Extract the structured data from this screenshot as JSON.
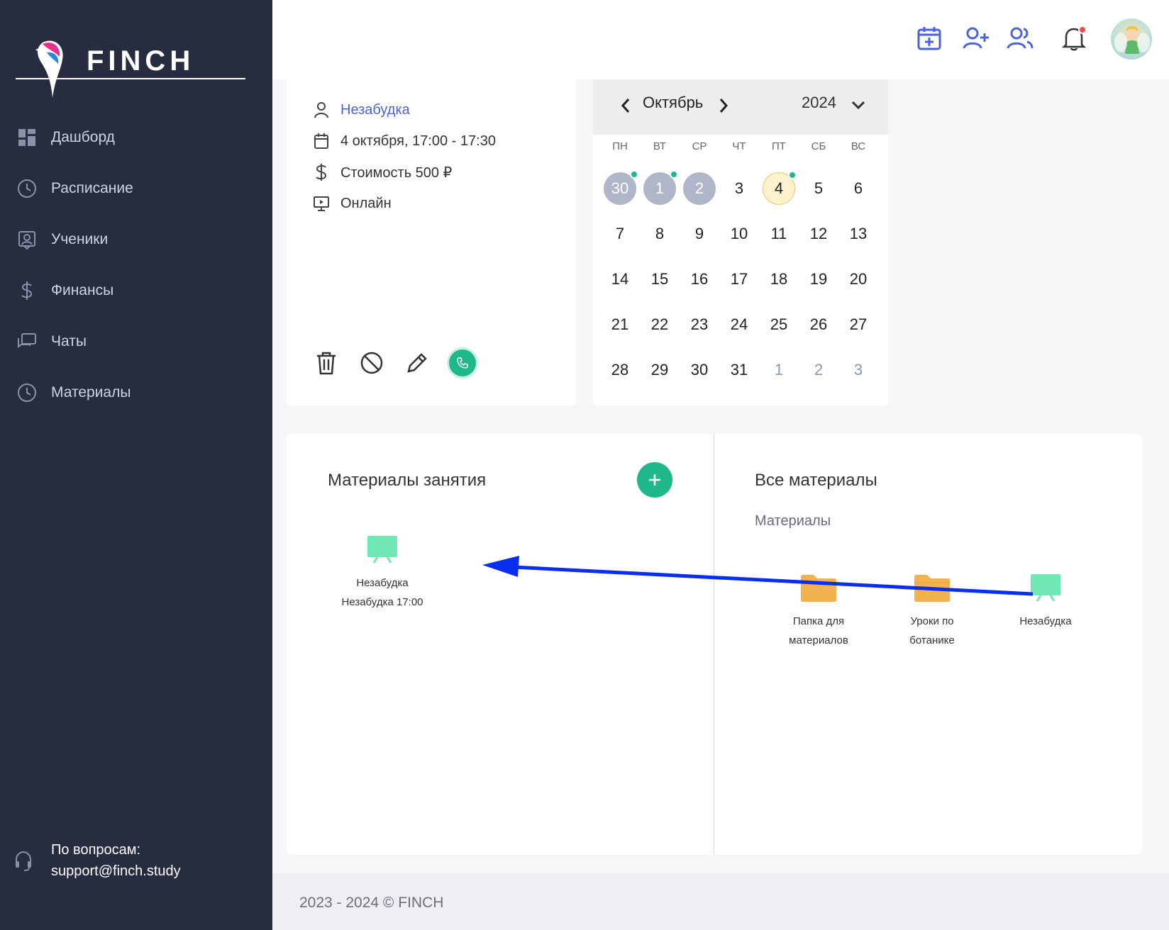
{
  "brand": {
    "name": "FINCH"
  },
  "sidebar": {
    "items": [
      {
        "label": "Дашборд",
        "icon": "dashboard-icon"
      },
      {
        "label": "Расписание",
        "icon": "clock-icon"
      },
      {
        "label": "Ученики",
        "icon": "student-icon"
      },
      {
        "label": "Финансы",
        "icon": "dollar-icon"
      },
      {
        "label": "Чаты",
        "icon": "chat-icon"
      },
      {
        "label": "Материалы",
        "icon": "clock-icon"
      }
    ],
    "support": {
      "line1": "По вопросам:",
      "line2": "support@finch.study"
    }
  },
  "topbar": {
    "icons": [
      "calendar-add-icon",
      "user-add-icon",
      "users-icon",
      "bell-icon"
    ],
    "accent": "#4b63d8",
    "notification_color": "#ef4d4d"
  },
  "lesson": {
    "student": "Незабудка",
    "datetime": "4 октября, 17:00 - 17:30",
    "price": "Стоимость 500 ₽",
    "format": "Онлайн"
  },
  "calendar": {
    "month": "Октябрь",
    "year": "2024",
    "weekdays": [
      "ПН",
      "ВТ",
      "СР",
      "ЧТ",
      "ПТ",
      "СБ",
      "ВС"
    ],
    "weeks": [
      [
        {
          "d": "30",
          "s": "past",
          "dot": true
        },
        {
          "d": "1",
          "s": "past",
          "dot": true
        },
        {
          "d": "2",
          "s": "past"
        },
        {
          "d": "3"
        },
        {
          "d": "4",
          "s": "today",
          "dot": true
        },
        {
          "d": "5"
        },
        {
          "d": "6"
        }
      ],
      [
        {
          "d": "7"
        },
        {
          "d": "8"
        },
        {
          "d": "9"
        },
        {
          "d": "10"
        },
        {
          "d": "11"
        },
        {
          "d": "12"
        },
        {
          "d": "13"
        }
      ],
      [
        {
          "d": "14"
        },
        {
          "d": "15"
        },
        {
          "d": "16"
        },
        {
          "d": "17"
        },
        {
          "d": "18"
        },
        {
          "d": "19"
        },
        {
          "d": "20"
        }
      ],
      [
        {
          "d": "21"
        },
        {
          "d": "22"
        },
        {
          "d": "23"
        },
        {
          "d": "24"
        },
        {
          "d": "25"
        },
        {
          "d": "26"
        },
        {
          "d": "27"
        }
      ],
      [
        {
          "d": "28"
        },
        {
          "d": "29"
        },
        {
          "d": "30"
        },
        {
          "d": "31"
        },
        {
          "d": "1",
          "s": "other"
        },
        {
          "d": "2",
          "s": "other"
        },
        {
          "d": "3",
          "s": "other"
        }
      ]
    ]
  },
  "materials": {
    "lesson_title": "Материалы занятия",
    "lesson_item": {
      "line1": "Незабудка",
      "line2": "Незабудка 17:00"
    },
    "all_title": "Все материалы",
    "all_subtitle": "Материалы",
    "all_items": [
      {
        "line1": "Папка для",
        "line2": "материалов",
        "type": "folder"
      },
      {
        "line1": "Уроки по",
        "line2": "ботанике",
        "type": "folder"
      },
      {
        "line1": "Незабудка",
        "line2": "",
        "type": "board"
      }
    ]
  },
  "footer": {
    "copyright": "2023 - 2024 © FINCH"
  }
}
